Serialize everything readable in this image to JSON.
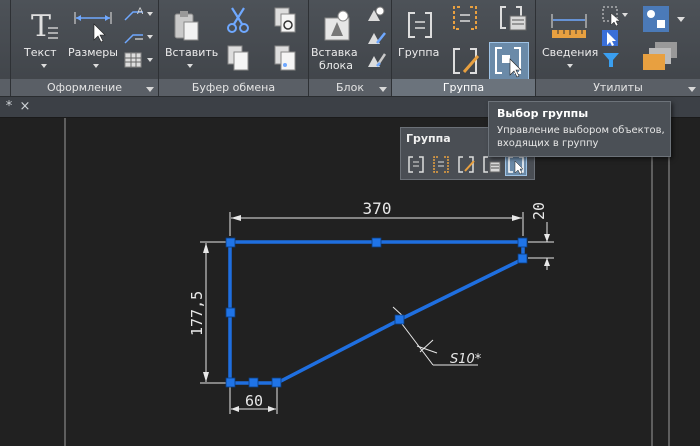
{
  "colors": {
    "canvas": "#212121",
    "ribbon": "#45494e",
    "panel_title": "#5a5f66",
    "selection": "#1f6fe0",
    "dimension": "#e8e8e8",
    "grip": "#1f74e8"
  },
  "ribbon": {
    "buttons": {
      "text": "Текст",
      "dimensions": "Размеры",
      "paste": "Вставить",
      "insert_block_1": "Вставка",
      "insert_block_2": "блока",
      "group": "Группа",
      "info": "Сведения"
    },
    "panels": {
      "annotation": "Оформление",
      "clipboard": "Буфер обмена",
      "block": "Блок",
      "group": "Группа",
      "utilities": "Утилиты"
    }
  },
  "tabs": {
    "close_glyph": "×",
    "left_glyph": "*"
  },
  "tooltip": {
    "title": "Выбор группы",
    "description": "Управление выбором объектов, входящих в группу"
  },
  "floating_toolbar": {
    "title": "Группа",
    "icons": [
      "group-icon",
      "ungroup-icon",
      "edit-group-icon",
      "group-manager-icon",
      "group-select-icon"
    ]
  },
  "drawing": {
    "dim_top": "370",
    "dim_right": "20",
    "dim_left": "177,5",
    "dim_bottom": "60",
    "weld_label": "S10*"
  }
}
